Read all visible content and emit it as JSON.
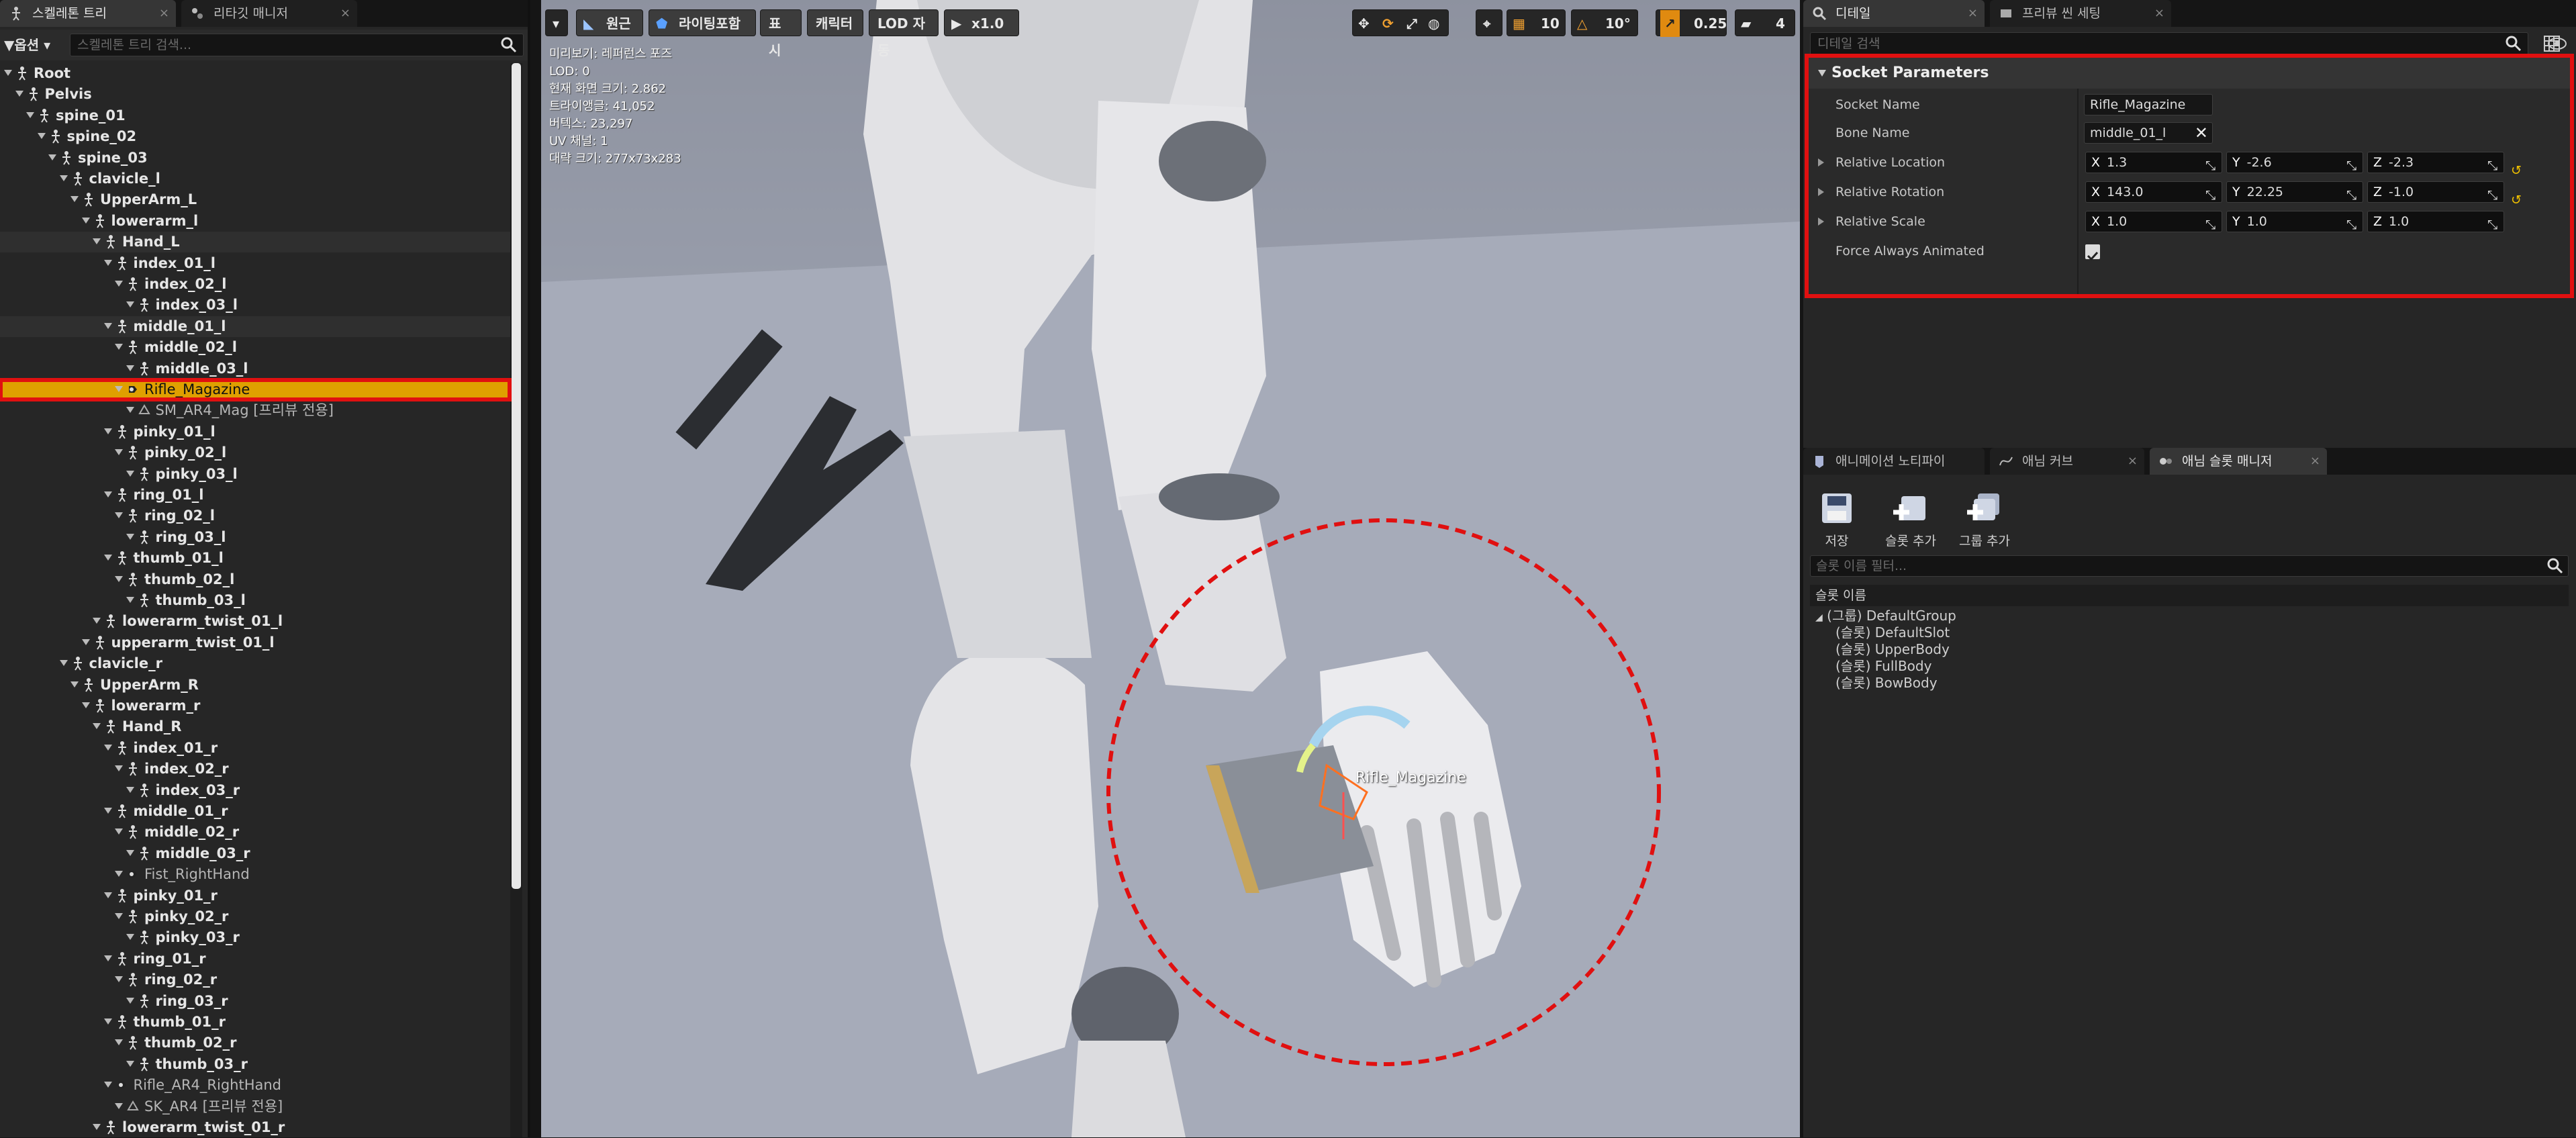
{
  "left_panel": {
    "tabs": [
      {
        "label": "스켈레톤 트리"
      },
      {
        "label": "리타깃 매니저"
      }
    ],
    "options_label": "▼옵션 ▾",
    "search_placeholder": "스켈레톤 트리 검색...",
    "tree": [
      {
        "label": "Root",
        "depth": 0,
        "icon": "bone-icon",
        "bold": true
      },
      {
        "label": "Pelvis",
        "depth": 1,
        "icon": "bone-icon",
        "bold": true
      },
      {
        "label": "spine_01",
        "depth": 2,
        "icon": "bone-icon",
        "bold": true
      },
      {
        "label": "spine_02",
        "depth": 3,
        "icon": "bone-icon",
        "bold": true
      },
      {
        "label": "spine_03",
        "depth": 4,
        "icon": "bone-icon",
        "bold": true
      },
      {
        "label": "clavicle_l",
        "depth": 5,
        "icon": "bone-icon",
        "bold": true
      },
      {
        "label": "UpperArm_L",
        "depth": 6,
        "icon": "bone-icon",
        "bold": true
      },
      {
        "label": "lowerarm_l",
        "depth": 7,
        "icon": "bone-icon",
        "bold": true
      },
      {
        "label": "Hand_L",
        "depth": 8,
        "icon": "bone-icon",
        "bold": true
      },
      {
        "label": "index_01_l",
        "depth": 9,
        "icon": "bone-icon",
        "bold": true
      },
      {
        "label": "index_02_l",
        "depth": 10,
        "icon": "bone-icon",
        "bold": true
      },
      {
        "label": "index_03_l",
        "depth": 11,
        "icon": "bone-icon",
        "bold": true
      },
      {
        "label": "middle_01_l",
        "depth": 9,
        "icon": "bone-icon",
        "bold": true
      },
      {
        "label": "middle_02_l",
        "depth": 10,
        "icon": "bone-icon",
        "bold": true
      },
      {
        "label": "middle_03_l",
        "depth": 11,
        "icon": "bone-icon",
        "bold": true
      },
      {
        "label": "Rifle_Magazine",
        "depth": 10,
        "icon": "socket-icon",
        "bold": false,
        "selected": true
      },
      {
        "label": "SM_AR4_Mag [프리뷰 전용]",
        "depth": 11,
        "icon": "mesh-icon",
        "bold": false
      },
      {
        "label": "pinky_01_l",
        "depth": 9,
        "icon": "bone-icon",
        "bold": true
      },
      {
        "label": "pinky_02_l",
        "depth": 10,
        "icon": "bone-icon",
        "bold": true
      },
      {
        "label": "pinky_03_l",
        "depth": 11,
        "icon": "bone-icon",
        "bold": true
      },
      {
        "label": "ring_01_l",
        "depth": 9,
        "icon": "bone-icon",
        "bold": true
      },
      {
        "label": "ring_02_l",
        "depth": 10,
        "icon": "bone-icon",
        "bold": true
      },
      {
        "label": "ring_03_l",
        "depth": 11,
        "icon": "bone-icon",
        "bold": true
      },
      {
        "label": "thumb_01_l",
        "depth": 9,
        "icon": "bone-icon",
        "bold": true
      },
      {
        "label": "thumb_02_l",
        "depth": 10,
        "icon": "bone-icon",
        "bold": true
      },
      {
        "label": "thumb_03_l",
        "depth": 11,
        "icon": "bone-icon",
        "bold": true
      },
      {
        "label": "lowerarm_twist_01_l",
        "depth": 8,
        "icon": "bone-icon",
        "bold": true
      },
      {
        "label": "upperarm_twist_01_l",
        "depth": 7,
        "icon": "bone-icon",
        "bold": true
      },
      {
        "label": "clavicle_r",
        "depth": 5,
        "icon": "bone-icon",
        "bold": true
      },
      {
        "label": "UpperArm_R",
        "depth": 6,
        "icon": "bone-icon",
        "bold": true
      },
      {
        "label": "lowerarm_r",
        "depth": 7,
        "icon": "bone-icon",
        "bold": true
      },
      {
        "label": "Hand_R",
        "depth": 8,
        "icon": "bone-icon",
        "bold": true
      },
      {
        "label": "index_01_r",
        "depth": 9,
        "icon": "bone-icon",
        "bold": true
      },
      {
        "label": "index_02_r",
        "depth": 10,
        "icon": "bone-icon",
        "bold": true
      },
      {
        "label": "index_03_r",
        "depth": 11,
        "icon": "bone-icon",
        "bold": true
      },
      {
        "label": "middle_01_r",
        "depth": 9,
        "icon": "bone-icon",
        "bold": true
      },
      {
        "label": "middle_02_r",
        "depth": 10,
        "icon": "bone-icon",
        "bold": true
      },
      {
        "label": "middle_03_r",
        "depth": 11,
        "icon": "bone-icon",
        "bold": true
      },
      {
        "label": "Fist_RightHand",
        "depth": 10,
        "icon": "socket-icon",
        "bold": false
      },
      {
        "label": "pinky_01_r",
        "depth": 9,
        "icon": "bone-icon",
        "bold": true
      },
      {
        "label": "pinky_02_r",
        "depth": 10,
        "icon": "bone-icon",
        "bold": true
      },
      {
        "label": "pinky_03_r",
        "depth": 11,
        "icon": "bone-icon",
        "bold": true
      },
      {
        "label": "ring_01_r",
        "depth": 9,
        "icon": "bone-icon",
        "bold": true
      },
      {
        "label": "ring_02_r",
        "depth": 10,
        "icon": "bone-icon",
        "bold": true
      },
      {
        "label": "ring_03_r",
        "depth": 11,
        "icon": "bone-icon",
        "bold": true
      },
      {
        "label": "thumb_01_r",
        "depth": 9,
        "icon": "bone-icon",
        "bold": true
      },
      {
        "label": "thumb_02_r",
        "depth": 10,
        "icon": "bone-icon",
        "bold": true
      },
      {
        "label": "thumb_03_r",
        "depth": 11,
        "icon": "bone-icon",
        "bold": true
      },
      {
        "label": "Rifle_AR4_RightHand",
        "depth": 9,
        "icon": "socket-icon",
        "bold": false
      },
      {
        "label": "SK_AR4 [프리뷰 전용]",
        "depth": 10,
        "icon": "mesh-icon",
        "bold": false
      },
      {
        "label": "lowerarm_twist_01_r",
        "depth": 8,
        "icon": "bone-icon",
        "bold": true
      }
    ]
  },
  "viewport": {
    "buttons": [
      {
        "label": "원근",
        "icon": "perspective-icon"
      },
      {
        "label": "라이팅포함",
        "icon": "lighting-icon"
      },
      {
        "label": "표시"
      },
      {
        "label": "캐릭터"
      },
      {
        "label": "LOD 자동"
      },
      {
        "label": "x1.0",
        "icon": "play-speed-icon"
      }
    ],
    "snap_values": {
      "grid": "10",
      "rotation": "10°",
      "scale": "0.25",
      "camera_speed": "4"
    },
    "stats": [
      "미리보기: 레퍼런스 포즈",
      "LOD: 0",
      "현재 화면 크기: 2.862",
      "트라이앵글: 41,052",
      "버텍스: 23,297",
      "UV 채널: 1",
      "대략 크기: 277x73x283"
    ],
    "socket_label": "Rifle_Magazine",
    "highlight_color": "#e01010"
  },
  "right_panel": {
    "tabs": [
      {
        "label": "디테일"
      },
      {
        "label": "프리뷰 씬 세팅"
      }
    ],
    "search_placeholder": "디테일 검색",
    "socket_section": {
      "title": "Socket Parameters",
      "socket_name_label": "Socket Name",
      "socket_name_value": "Rifle_Magazine",
      "bone_name_label": "Bone Name",
      "bone_name_value": "middle_01_l",
      "location_label": "Relative Location",
      "location": {
        "x": "1.3",
        "y": "-2.6",
        "z": "-2.3"
      },
      "rotation_label": "Relative Rotation",
      "rotation": {
        "x": "143.0",
        "y": "22.25",
        "z": "-1.0"
      },
      "scale_label": "Relative Scale",
      "scale": {
        "x": "1.0",
        "y": "1.0",
        "z": "1.0"
      },
      "force_label": "Force Always Animated",
      "force_checked": true
    },
    "bottom_tabs": [
      {
        "label": "애니메이션 노티파이"
      },
      {
        "label": "애님 커브"
      },
      {
        "label": "애님 슬롯 매니저"
      }
    ],
    "toolbar": [
      {
        "label": "저장",
        "icon": "save-icon"
      },
      {
        "label": "슬롯 추가",
        "icon": "add-slot-icon"
      },
      {
        "label": "그룹 추가",
        "icon": "add-group-icon"
      }
    ],
    "slot_filter_placeholder": "슬롯 이름 필터...",
    "slot_header": "슬롯 이름",
    "slots": [
      {
        "label": "(그룹) DefaultGroup"
      },
      {
        "label": "(슬롯) DefaultSlot"
      },
      {
        "label": "(슬롯) UpperBody"
      },
      {
        "label": "(슬롯) FullBody"
      },
      {
        "label": "(슬롯) BowBody"
      }
    ]
  }
}
